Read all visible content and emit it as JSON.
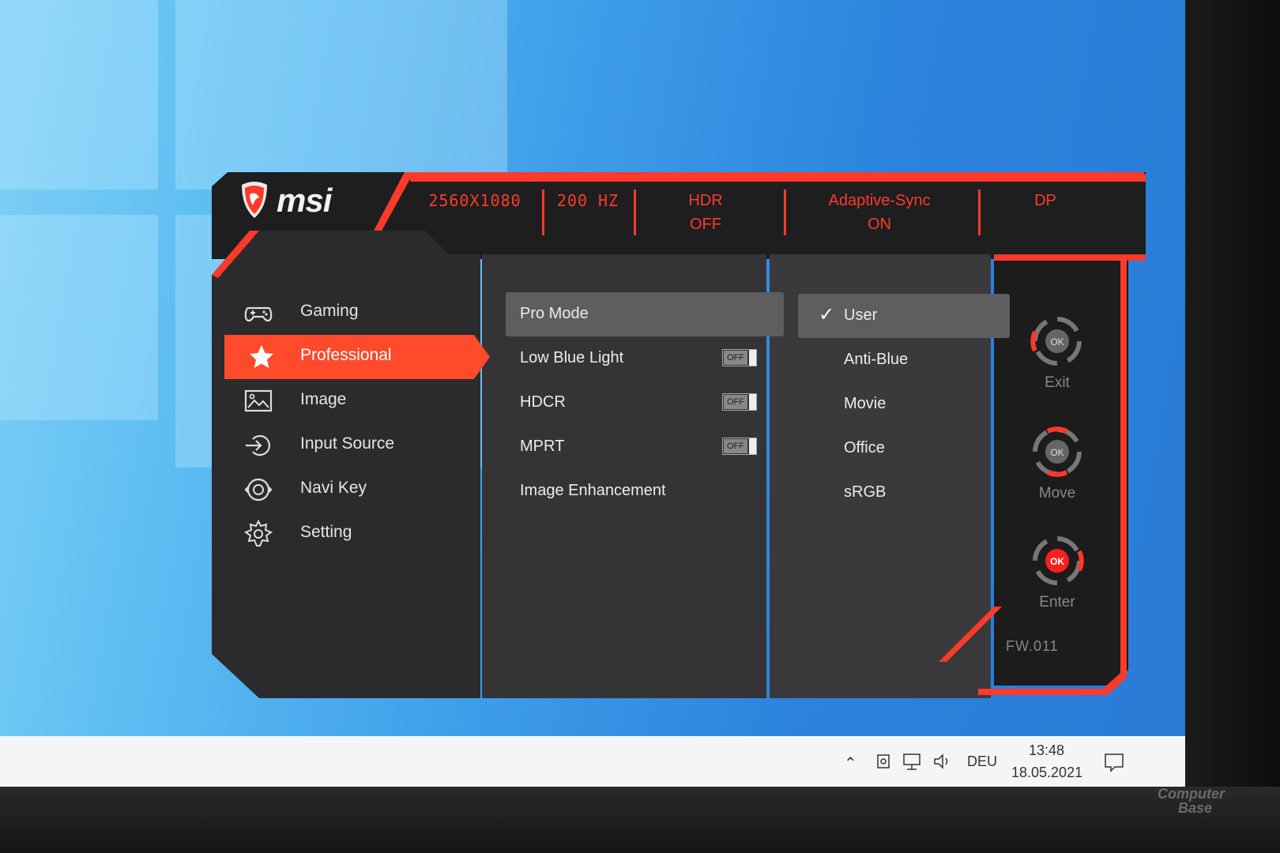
{
  "osd": {
    "brand": "msi",
    "status": {
      "resolution": "2560X1080",
      "refresh": "200 HZ",
      "hdr_label": "HDR",
      "hdr_value": "OFF",
      "sync_label": "Adaptive-Sync",
      "sync_value": "ON",
      "input": "DP"
    },
    "menu": [
      {
        "label": "Gaming",
        "icon": "gamepad-icon"
      },
      {
        "label": "Professional",
        "icon": "star-icon",
        "active": true
      },
      {
        "label": "Image",
        "icon": "image-icon"
      },
      {
        "label": "Input Source",
        "icon": "input-source-icon"
      },
      {
        "label": "Navi Key",
        "icon": "navi-key-icon"
      },
      {
        "label": "Setting",
        "icon": "gear-icon"
      }
    ],
    "submenu": [
      {
        "label": "Pro Mode",
        "selected": true
      },
      {
        "label": "Low Blue Light",
        "toggle": "OFF"
      },
      {
        "label": "HDCR",
        "toggle": "OFF"
      },
      {
        "label": "MPRT",
        "toggle": "OFF"
      },
      {
        "label": "Image Enhancement"
      }
    ],
    "options": [
      {
        "label": "User",
        "checked": true
      },
      {
        "label": "Anti-Blue"
      },
      {
        "label": "Movie"
      },
      {
        "label": "Office"
      },
      {
        "label": "sRGB"
      }
    ],
    "nav_hints": [
      {
        "label": "Exit",
        "icon": "exit-joystick-icon",
        "key": "OK"
      },
      {
        "label": "Move",
        "icon": "move-joystick-icon",
        "key": "OK"
      },
      {
        "label": "Enter",
        "icon": "enter-joystick-icon",
        "key": "OK"
      }
    ],
    "firmware": "FW.011"
  },
  "taskbar": {
    "language": "DEU",
    "time": "13:48",
    "date": "18.05.2021",
    "tray_icons": [
      "chevron-up-icon",
      "camera-icon",
      "network-icon",
      "volume-icon",
      "notification-icon"
    ]
  },
  "watermark": {
    "line1": "Computer",
    "line2": "Base"
  },
  "colors": {
    "accent": "#ff3a2a",
    "panel": "#2c2c2e",
    "selected": "#5e5e60"
  }
}
